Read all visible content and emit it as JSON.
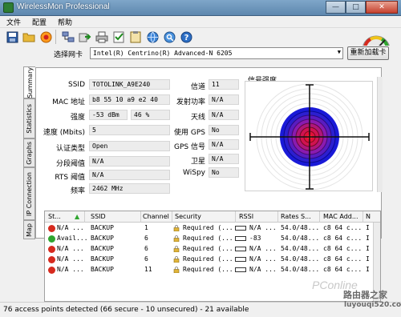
{
  "window": {
    "title": "WirelessMon Professional"
  },
  "menu": [
    "文件",
    "配置",
    "帮助"
  ],
  "toolbar": {
    "icons": [
      "save-icon",
      "open-folder-icon",
      "record-icon",
      "network-icon",
      "export-icon",
      "print-icon",
      "checklist-icon",
      "clipboard-icon",
      "globe-icon",
      "globe-search-icon",
      "help-icon"
    ]
  },
  "adapter": {
    "label": "选择网卡",
    "value": "Intel(R) Centrino(R) Advanced-N 6205",
    "reload_label": "重新加载卡"
  },
  "tabs": [
    "Summary",
    "Statistics",
    "Graphs",
    "IP Connection",
    "Map"
  ],
  "summary": {
    "left": [
      {
        "label": "SSID",
        "value": "TOTOLINK_A9E240"
      },
      {
        "label": "MAC 地址",
        "value": "b8 55 10 a9 e2 40"
      },
      {
        "label": "强度",
        "value": "-53 dBm",
        "value2": "46 %"
      },
      {
        "label": "速度 (Mbits)",
        "value": "5"
      },
      {
        "label": "认证类型",
        "value": "Open"
      },
      {
        "label": "分段阈值",
        "value": "N/A"
      },
      {
        "label": "RTS 阈值",
        "value": "N/A"
      },
      {
        "label": "频率",
        "value": "2462 MHz"
      }
    ],
    "right": [
      {
        "label": "信道",
        "value": "11"
      },
      {
        "label": "发射功率",
        "value": "N/A"
      },
      {
        "label": "天线",
        "value": "N/A"
      },
      {
        "label": "使用 GPS",
        "value": "No"
      },
      {
        "label": "GPS 信号",
        "value": "N/A"
      },
      {
        "label": "卫星",
        "value": "N/A"
      },
      {
        "label": "WiSpy",
        "value": "No"
      }
    ],
    "signal_title": "信号强度"
  },
  "table": {
    "columns": [
      "St...",
      "SSID",
      "Channel",
      "Security",
      "RSSI",
      "Rates S...",
      "MAC Add...",
      "N"
    ],
    "rows": [
      {
        "status": "N/A ...",
        "color": "#d62a1e",
        "ssid": "BACKUP",
        "channel": "1",
        "security": "Required (...",
        "rssi": "N/A ...",
        "rates": "54.0/48...",
        "mac": "c8 64 c...",
        "n": "I"
      },
      {
        "status": "Avail...",
        "color": "#2fa52f",
        "ssid": "BACKUP",
        "channel": "6",
        "security": "Required (...",
        "rssi": "-83",
        "rates": "54.0/48...",
        "mac": "c8 64 c...",
        "n": "I"
      },
      {
        "status": "N/A ...",
        "color": "#d62a1e",
        "ssid": "BACKUP",
        "channel": "6",
        "security": "Required (...",
        "rssi": "N/A ...",
        "rates": "54.0/48...",
        "mac": "c8 64 c...",
        "n": "I"
      },
      {
        "status": "N/A ...",
        "color": "#d62a1e",
        "ssid": "BACKUP",
        "channel": "6",
        "security": "Required (...",
        "rssi": "N/A ...",
        "rates": "54.0/48...",
        "mac": "c8 64 c...",
        "n": "I"
      },
      {
        "status": "N/A ...",
        "color": "#d62a1e",
        "ssid": "BACKUP",
        "channel": "11",
        "security": "Required (...",
        "rssi": "N/A ...",
        "rates": "54.0/48...",
        "mac": "c8 64 c...",
        "n": "I"
      }
    ]
  },
  "status_bar": "76 access points detected (66 secure - 10 unsecured) - 21 available",
  "watermark": {
    "brand": "PConline",
    "site_cn": "路由器之家",
    "site_url": "luyouqi520.com"
  },
  "colors": {
    "ring_outer": "#1a1ad8",
    "ring_mid": "#8a1bb0",
    "ring_inner": "#e0103a",
    "title_bar": "#6b93b8"
  }
}
